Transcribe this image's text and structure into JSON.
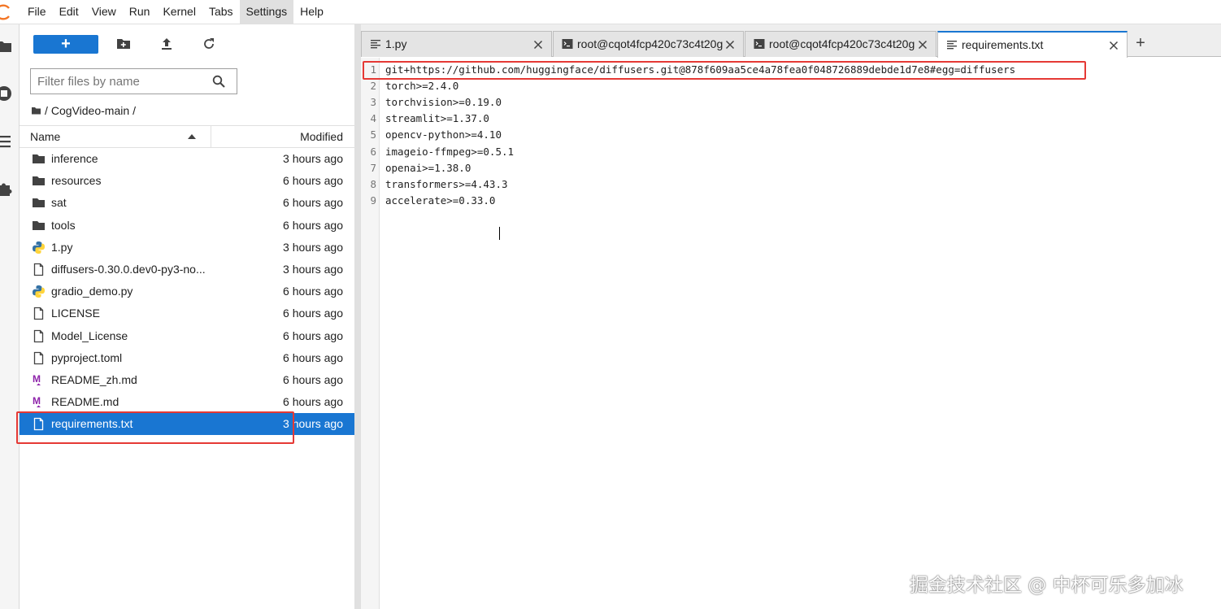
{
  "menubar": {
    "items": [
      "File",
      "Edit",
      "View",
      "Run",
      "Kernel",
      "Tabs",
      "Settings",
      "Help"
    ],
    "active": "Settings"
  },
  "colors": {
    "accent": "#1976d2",
    "highlight": "#e53935",
    "markdown": "#8e24aa",
    "python_blue": "#3572a5",
    "python_yellow": "#ffd43b"
  },
  "sidebar": {
    "icons": [
      "folder-icon",
      "running-icon",
      "toc-icon",
      "extension-icon"
    ]
  },
  "filebrowser": {
    "new_label": "+",
    "filter_placeholder": "Filter files by name",
    "breadcrumb": {
      "separator": "/",
      "folder": "CogVideo-main",
      "trailing": "/"
    },
    "header": {
      "name": "Name",
      "modified": "Modified"
    },
    "files": [
      {
        "name": "inference",
        "modified": "3 hours ago",
        "icon": "folder-icon"
      },
      {
        "name": "resources",
        "modified": "6 hours ago",
        "icon": "folder-icon"
      },
      {
        "name": "sat",
        "modified": "6 hours ago",
        "icon": "folder-icon"
      },
      {
        "name": "tools",
        "modified": "6 hours ago",
        "icon": "folder-icon"
      },
      {
        "name": "1.py",
        "modified": "3 hours ago",
        "icon": "python-icon"
      },
      {
        "name": "diffusers-0.30.0.dev0-py3-no...",
        "modified": "3 hours ago",
        "icon": "file-icon"
      },
      {
        "name": "gradio_demo.py",
        "modified": "6 hours ago",
        "icon": "python-icon"
      },
      {
        "name": "LICENSE",
        "modified": "6 hours ago",
        "icon": "file-icon"
      },
      {
        "name": "Model_License",
        "modified": "6 hours ago",
        "icon": "file-icon"
      },
      {
        "name": "pyproject.toml",
        "modified": "6 hours ago",
        "icon": "file-icon"
      },
      {
        "name": "README_zh.md",
        "modified": "6 hours ago",
        "icon": "markdown-icon"
      },
      {
        "name": "README.md",
        "modified": "6 hours ago",
        "icon": "markdown-icon"
      },
      {
        "name": "requirements.txt",
        "modified": "3 hours ago",
        "icon": "file-icon",
        "selected": true
      }
    ]
  },
  "tabs": [
    {
      "label": "1.py",
      "icon": "text-file-icon"
    },
    {
      "label": "root@cqot4fcp420c73c4t20g",
      "icon": "terminal-icon"
    },
    {
      "label": "root@cqot4fcp420c73c4t20g",
      "icon": "terminal-icon"
    },
    {
      "label": "requirements.txt",
      "icon": "text-file-icon",
      "active": true
    }
  ],
  "tab_add_label": "+",
  "editor": {
    "lines": [
      "git+https://github.com/huggingface/diffusers.git@878f609aa5ce4a78fea0f048726889debde1d7e8#egg=diffusers",
      "torch>=2.4.0",
      "torchvision>=0.19.0",
      "streamlit>=1.37.0",
      "opencv-python>=4.10",
      "imageio-ffmpeg>=0.5.1",
      "openai>=1.38.0",
      "transformers>=4.43.3",
      "accelerate>=0.33.0"
    ]
  },
  "watermark": "掘金技术社区 @ 中杯可乐多加冰"
}
